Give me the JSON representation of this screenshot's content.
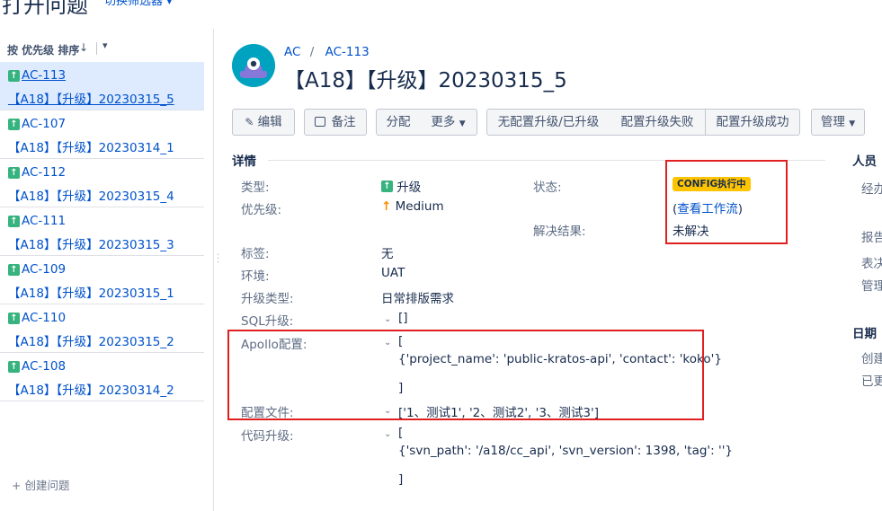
{
  "header": {
    "page_title": "打开问题",
    "filter_switch": "切换筛选器 ▾"
  },
  "sort": {
    "label": "按 优先级 排序",
    "arrow": "↓",
    "dropdown": "▾"
  },
  "issues": [
    {
      "key": "AC-113",
      "summary": "【A18】【升级】20230315_5"
    },
    {
      "key": "AC-107",
      "summary": "【A18】【升级】20230314_1"
    },
    {
      "key": "AC-112",
      "summary": "【A18】【升级】20230315_4"
    },
    {
      "key": "AC-111",
      "summary": "【A18】【升级】20230315_3"
    },
    {
      "key": "AC-109",
      "summary": "【A18】【升级】20230315_1"
    },
    {
      "key": "AC-110",
      "summary": "【A18】【升级】20230315_2"
    },
    {
      "key": "AC-108",
      "summary": "【A18】【升级】20230314_2"
    }
  ],
  "create_issue": "+ 创建问题",
  "breadcrumb": {
    "project": "AC",
    "sep": "/",
    "key": "AC-113"
  },
  "issue_title": "【A18】【升级】20230315_5",
  "toolbar": {
    "edit": "编辑",
    "comment": "备注",
    "assign": "分配",
    "more": "更多",
    "no_config": "无配置升级/已升级",
    "config_fail": "配置升级失败",
    "config_success": "配置升级成功",
    "admin": "管理"
  },
  "details": {
    "title": "详情",
    "type_label": "类型:",
    "type_value": "升级",
    "priority_label": "优先级:",
    "priority_value": "Medium",
    "status_label": "状态:",
    "status_badge": "CONFIG执行中",
    "workflow_open": "(",
    "workflow_link": "查看工作流",
    "workflow_close": ")",
    "resolution_label": "解决结果:",
    "resolution_value": "未解决",
    "labels_label": "标签:",
    "labels_value": "无",
    "env_label": "环境:",
    "env_value": "UAT",
    "upgrade_type_label": "升级类型:",
    "upgrade_type_value": "日常排版需求",
    "sql_label": "SQL升级:",
    "sql_value": "[]",
    "apollo_label": "Apollo配置:",
    "apollo_open": "[",
    "apollo_value": "{'project_name': 'public-kratos-api', 'contact': 'koko'}",
    "apollo_close": "]",
    "config_file_label": "配置文件:",
    "config_file_value": "['1、测试1', '2、测试2', '3、测试3']",
    "code_label": "代码升级:",
    "code_open": "[",
    "code_value": "{'svn_path': '/a18/cc_api', 'svn_version': 1398, 'tag': ''}",
    "code_close": "]"
  },
  "people": {
    "title": "人员",
    "assignee": "经办",
    "reporter": "报告",
    "votes": "表决",
    "watchers": "管理"
  },
  "dates": {
    "title": "日期",
    "created": "创建",
    "updated": "已更"
  },
  "colors": {
    "link": "#0052cc",
    "badge": "#ffc400",
    "highlight_box": "#e02020",
    "active_item_bg": "#deebff",
    "upgrade_icon": "#36b37e"
  }
}
